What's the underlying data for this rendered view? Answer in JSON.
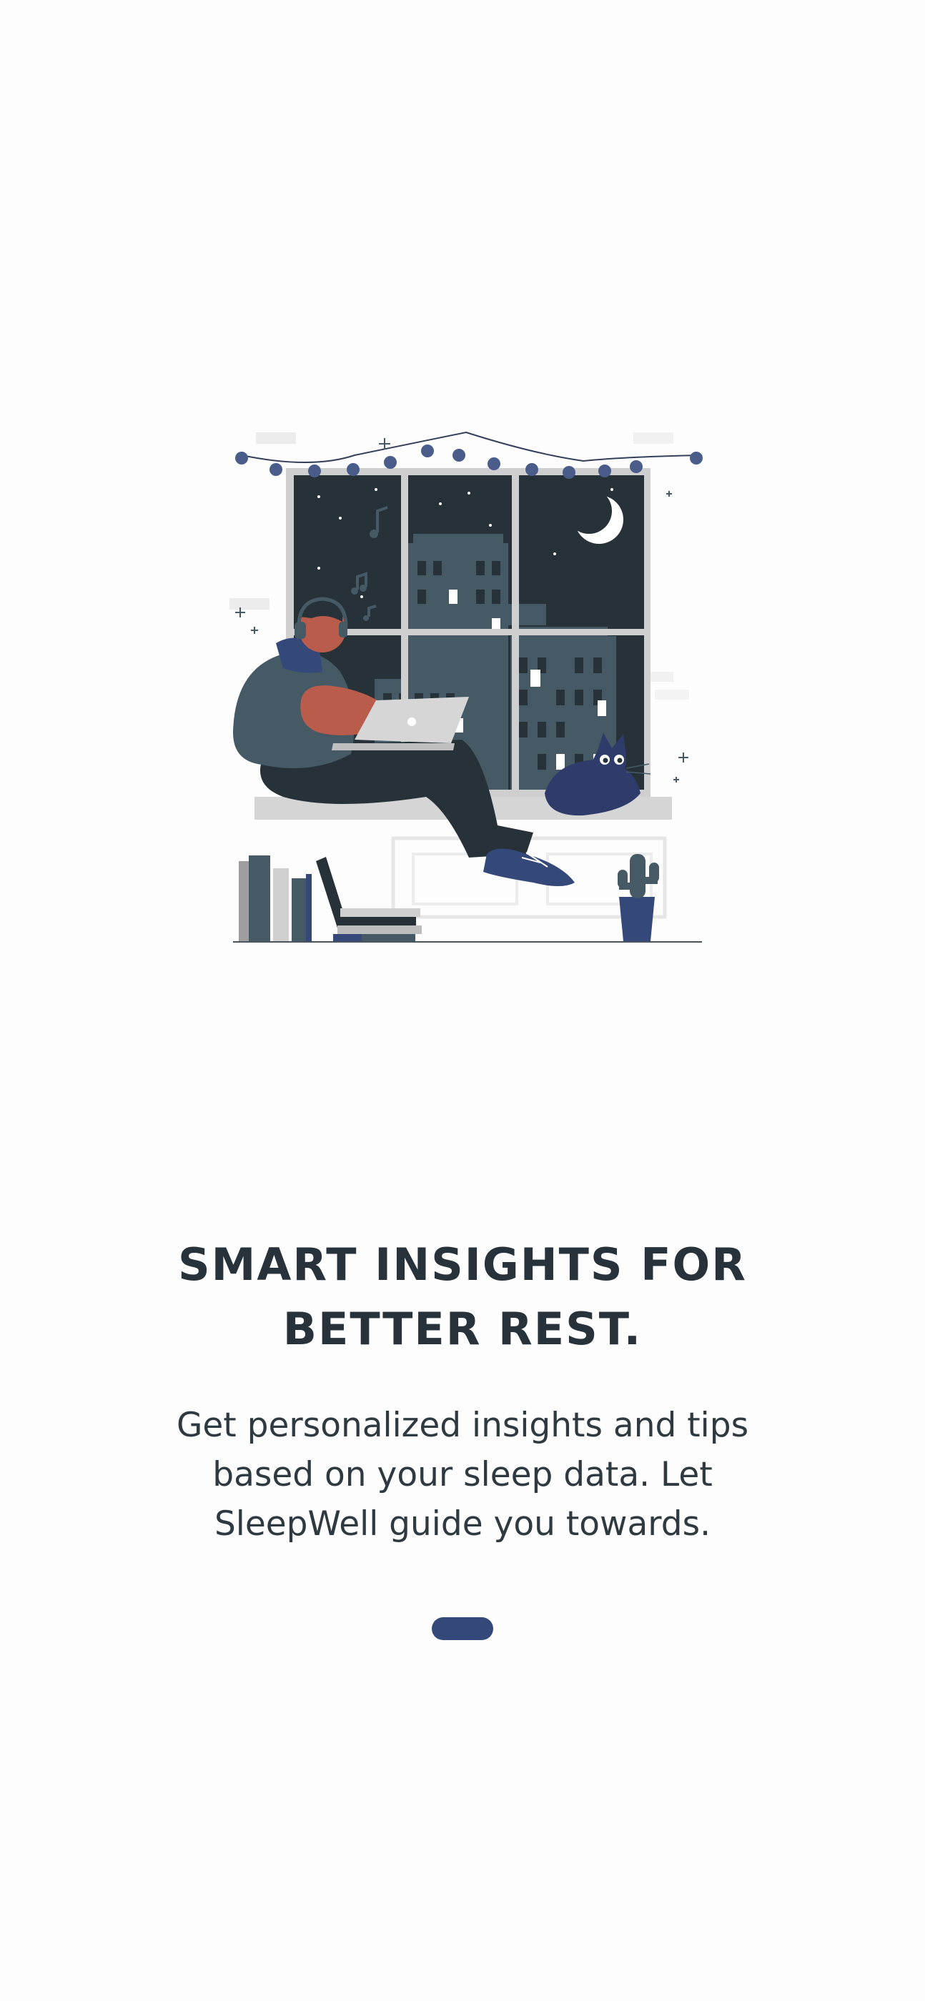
{
  "onboarding": {
    "title": "SMART INSIGHTS FOR BETTER REST.",
    "description": "Get personalized insights and tips based on your sleep data. Let SleepWell guide you towards.",
    "illustration": "person-with-laptop-at-night-window-illustration"
  },
  "pager": {
    "total_pages": 1,
    "active_index": 0
  },
  "colors": {
    "background": "#fdfdfd",
    "text": "#27323a",
    "accent": "#34497a",
    "night_sky": "#263238",
    "buildings": "#455a64"
  }
}
